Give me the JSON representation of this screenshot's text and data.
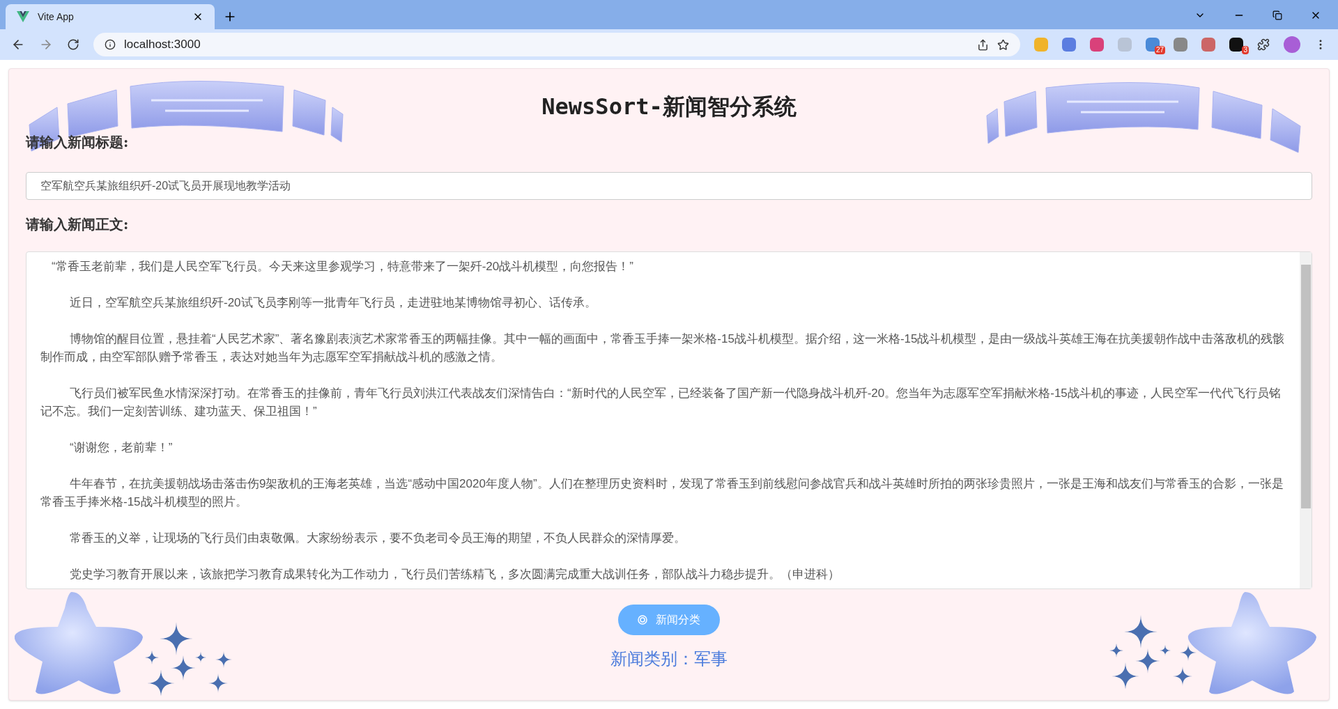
{
  "browser": {
    "tabs": [
      {
        "title": "Vite App",
        "selected": true
      }
    ],
    "address": "localhost:3000",
    "extension_badges": [
      "27",
      "3"
    ]
  },
  "page": {
    "title": "NewsSort-新闻智分系统",
    "title_label": "请输入新闻标题:",
    "title_value": "空军航空兵某旅组织歼-20试飞员开展现地教学活动",
    "body_label": "请输入新闻正文:",
    "body_paragraphs": [
      {
        "text": "“常香玉老前辈，我们是人民空军飞行员。今天来这里参观学习，特意带来了一架歼-20战斗机模型，向您报告！”",
        "indented": false
      },
      {
        "text": "近日，空军航空兵某旅组织歼-20试飞员李刚等一批青年飞行员，走进驻地某博物馆寻初心、话传承。",
        "indented": true
      },
      {
        "text": "博物馆的醒目位置，悬挂着“人民艺术家”、著名豫剧表演艺术家常香玉的两幅挂像。其中一幅的画面中，常香玉手捧一架米格-15战斗机模型。据介绍，这一米格-15战斗机模型，是由一级战斗英雄王海在抗美援朝作战中击落敌机的残骸制作而成，由空军部队赠予常香玉，表达对她当年为志愿军空军捐献战斗机的感激之情。",
        "indented": true
      },
      {
        "text": "飞行员们被军民鱼水情深深打动。在常香玉的挂像前，青年飞行员刘洪江代表战友们深情告白：“新时代的人民空军，已经装备了国产新一代隐身战斗机歼-20。您当年为志愿军空军捐献米格-15战斗机的事迹，人民空军一代代飞行员铭记不忘。我们一定刻苦训练、建功蓝天、保卫祖国！”",
        "indented": true
      },
      {
        "text": "“谢谢您，老前辈！”",
        "indented": true
      },
      {
        "text": "牛年春节，在抗美援朝战场击落击伤9架敌机的王海老英雄，当选“感动中国2020年度人物”。人们在整理历史资料时，发现了常香玉到前线慰问参战官兵和战斗英雄时所拍的两张珍贵照片，一张是王海和战友们与常香玉的合影，一张是常香玉手捧米格-15战斗机模型的照片。",
        "indented": true
      },
      {
        "text": "常香玉的义举，让现场的飞行员们由衷敬佩。大家纷纷表示，要不负老司令员王海的期望，不负人民群众的深情厚爱。",
        "indented": true
      },
      {
        "text": "党史学习教育开展以来，该旅把学习教育成果转化为工作动力，飞行员们苦练精飞，多次圆满完成重大战训任务，部队战斗力稳步提升。（申进科）",
        "indented": true
      }
    ],
    "classify_button": "新闻分类",
    "result": "新闻类别：军事"
  }
}
